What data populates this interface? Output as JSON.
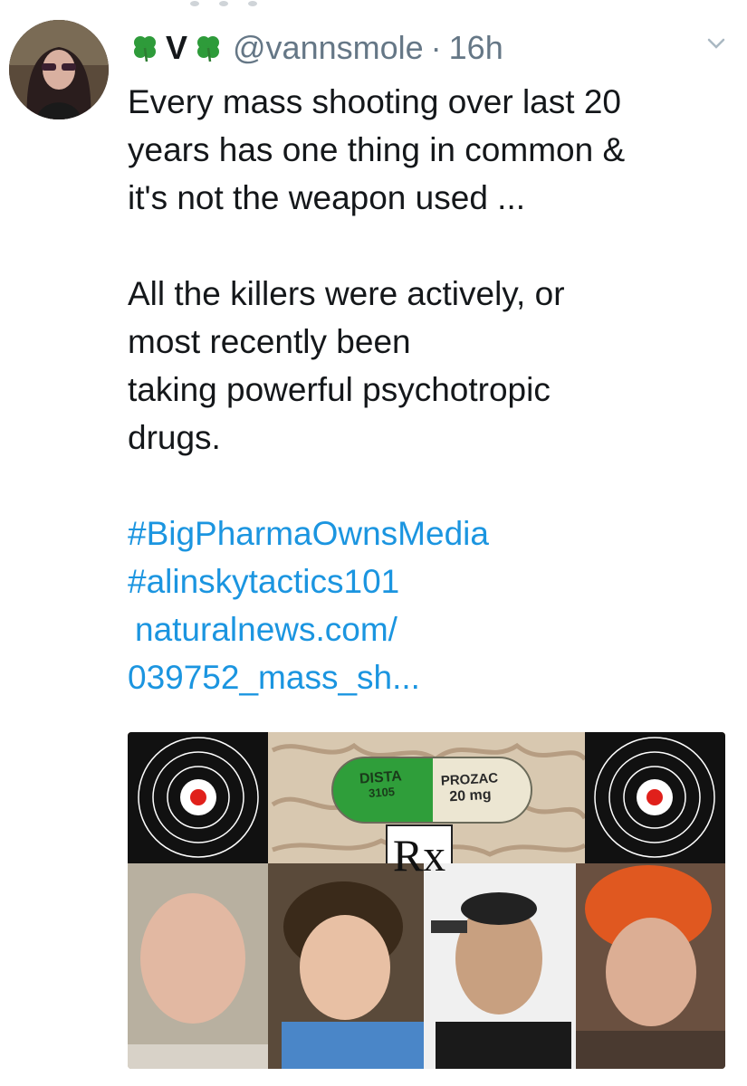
{
  "tweet": {
    "display_name": "V",
    "handle": "@vannsmole",
    "separator": "·",
    "time": "16h",
    "name_icon": "four-leaf-clover-icon",
    "menu_icon": "chevron-down-icon",
    "text": {
      "line1": "Every mass shooting over last 20",
      "line2": "years has one thing in common &",
      "line3": "it's not the weapon used ...",
      "line4": "All the killers were actively, or",
      "line5": "most recently been",
      "line6": "taking powerful psychotropic",
      "line7": "drugs."
    },
    "hashtags": [
      "#BigPharmaOwnsMedia",
      "#alinskytactics101"
    ],
    "link": {
      "line1": "naturalnews.com/",
      "line2": "039752_mass_sh..."
    }
  },
  "media": {
    "pill_left": "DISTA",
    "pill_left_code": "3105",
    "pill_right": "PROZAC",
    "pill_right_dose": "20 mg",
    "rx": "Rx"
  },
  "colors": {
    "link": "#1b95e0",
    "meta": "#657786",
    "text": "#14171a",
    "pill_green": "#2f9e3a",
    "target_red": "#e0201b"
  }
}
